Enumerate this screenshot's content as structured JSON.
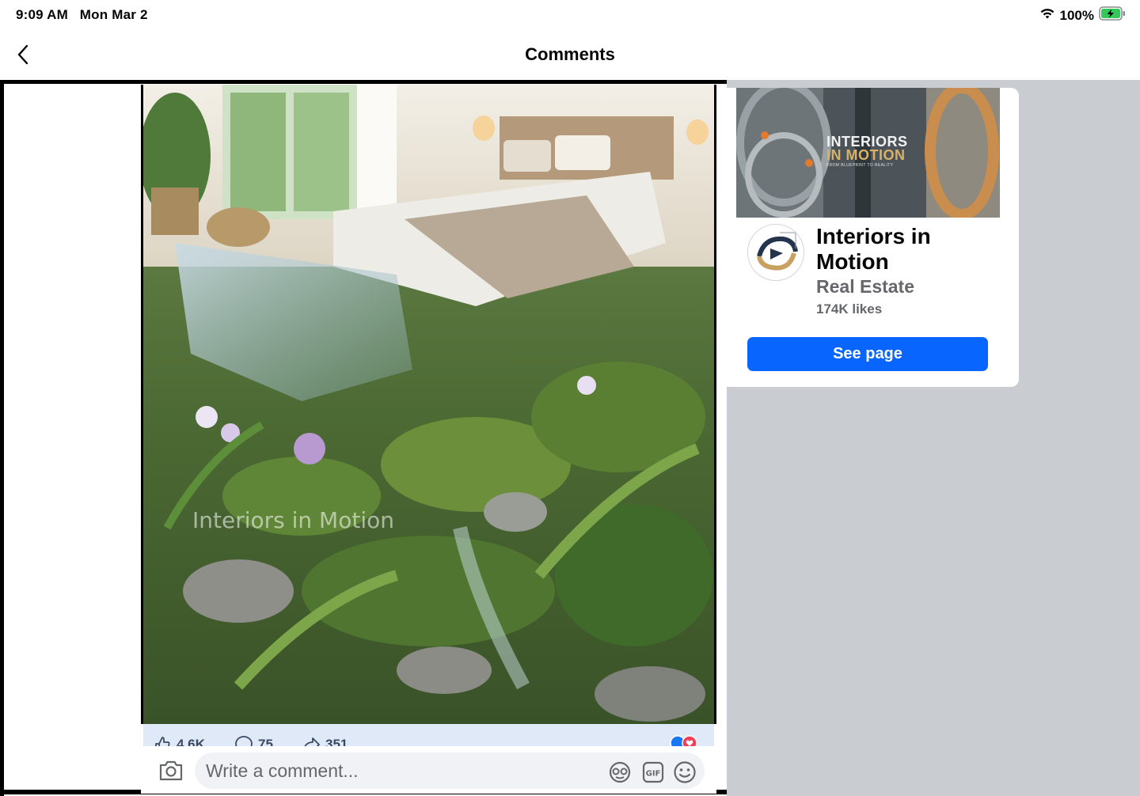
{
  "status_bar": {
    "time": "9:09 AM",
    "date": "Mon Mar 2",
    "battery": "100%"
  },
  "nav": {
    "title": "Comments"
  },
  "post": {
    "watermark": "Interiors in Motion",
    "likes": "4.6K",
    "comments": "75",
    "shares": "351"
  },
  "composer": {
    "placeholder": "Write a comment..."
  },
  "page_card": {
    "cover_title_line1": "INTERIORS",
    "cover_title_line2": "IN MOTION",
    "cover_tagline": "FROM BLUEPRINT TO REALITY",
    "name": "Interiors in Motion",
    "category": "Real Estate",
    "likes": "174K likes",
    "button_label": "See page"
  },
  "colors": {
    "accent": "#0866ff",
    "right_pane_bg": "#c9ccd1"
  }
}
